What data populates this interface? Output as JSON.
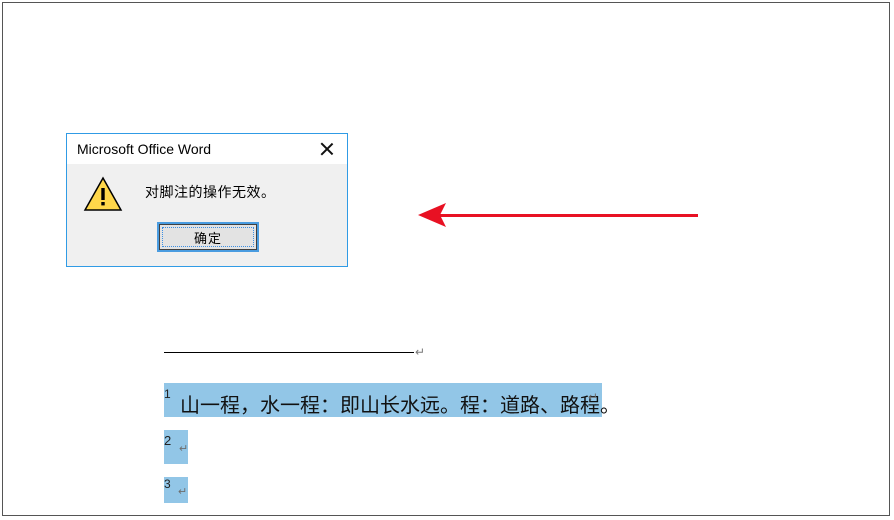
{
  "dialog": {
    "title": "Microsoft Office Word",
    "message": "对脚注的操作无效。",
    "ok_label": "确定"
  },
  "footnotes": {
    "items": [
      {
        "num": "1",
        "text": "山一程，水一程：即山长水远。程：道路、路程。"
      },
      {
        "num": "2",
        "text": ""
      },
      {
        "num": "3",
        "text": ""
      }
    ]
  },
  "marks": {
    "paragraph": "↵"
  },
  "colors": {
    "dialog_border": "#309be5",
    "arrow": "#e81123",
    "highlight": "#92c6e7"
  }
}
